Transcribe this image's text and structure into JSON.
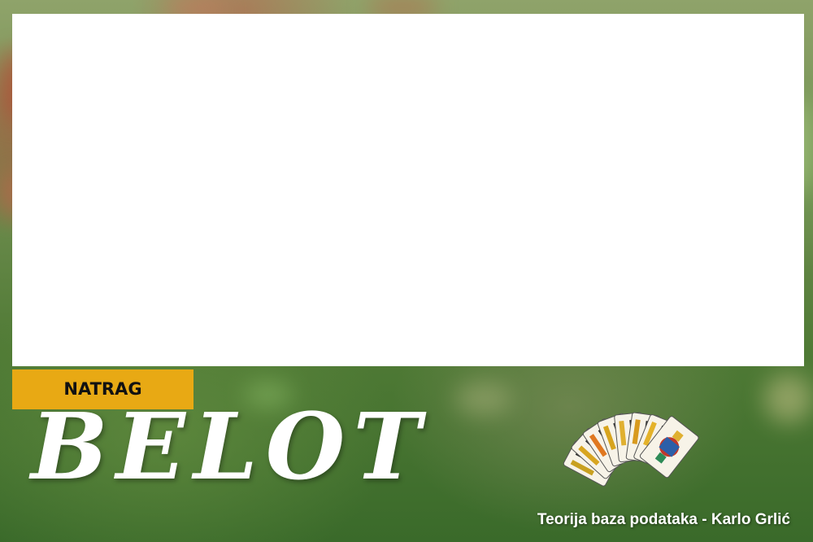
{
  "frame": {
    "content": ""
  },
  "nav": {
    "back_label": "NATRAG"
  },
  "hero": {
    "title": "BELOT",
    "cards_icon": "playing-cards-fan-icon"
  },
  "footer": {
    "credit": "Teorija baza podataka - Karlo Grlić"
  },
  "colors": {
    "accent": "#e8a914",
    "background": "#4f7a35",
    "frame": "#ffffff",
    "title": "#ffffff"
  }
}
